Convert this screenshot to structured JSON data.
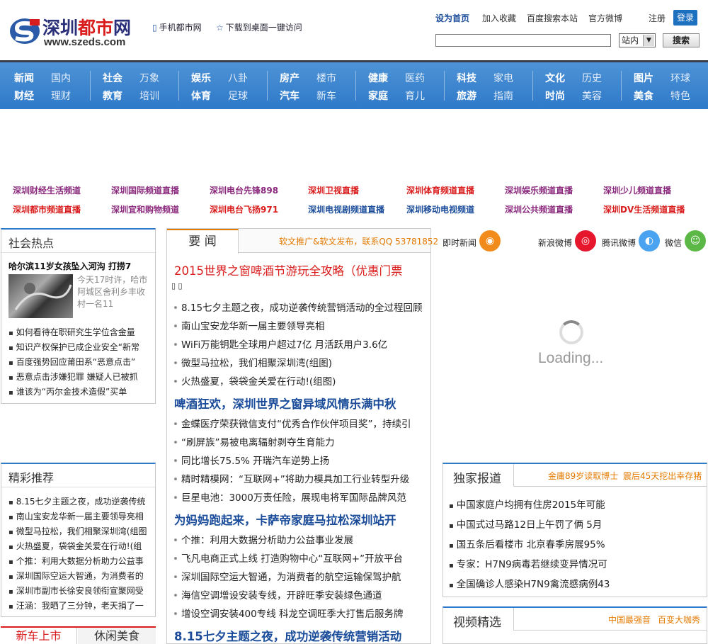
{
  "header": {
    "logo_name_a": "深圳",
    "logo_name_b": "都市",
    "logo_name_c": "网",
    "logo_url": "www.szeds.com",
    "mobile_link": "手机都市网",
    "desktop_link": "下载到桌面一键访问",
    "set_home": "设为首页",
    "add_fav": "加入收藏",
    "baidu_search": "百度搜索本站",
    "weibo": "官方微博",
    "register": "注册",
    "login": "登录",
    "search_placeholder": "",
    "search_scope": "站内",
    "search_button": "搜索"
  },
  "nav": [
    [
      "新闻",
      "国内",
      "财经",
      "理财"
    ],
    [
      "社会",
      "万象",
      "教育",
      "培训"
    ],
    [
      "娱乐",
      "八卦",
      "体育",
      "足球"
    ],
    [
      "房产",
      "楼市",
      "汽车",
      "新车"
    ],
    [
      "健康",
      "医药",
      "家庭",
      "育儿"
    ],
    [
      "科技",
      "家电",
      "旅游",
      "指南"
    ],
    [
      "文化",
      "历史",
      "时尚",
      "美容"
    ],
    [
      "图片",
      "环球",
      "美食",
      "特色"
    ]
  ],
  "channels": {
    "row1": [
      "深圳财经生活频道",
      "深圳国际频道直播",
      "深圳电台先锋898",
      "深圳卫视直播",
      "深圳体育频道直播",
      "深圳娱乐频道直播",
      "深圳少儿频道直播"
    ],
    "row2": [
      "深圳都市频道直播",
      "深圳宜和购物频道",
      "深圳电台飞扬971",
      "深圳电视剧频道直播",
      "深圳移动电视频道",
      "深圳公共频道直播",
      "深圳DV生活频道直播"
    ],
    "colors": {
      "purple": "#8b2a7d",
      "red": "#d91c1c",
      "blue": "#1a4c9a"
    }
  },
  "hot": {
    "title": "社会热点",
    "top_title": "哈尔滨11岁女孩坠入河沟 打捞7",
    "top_summary": "今天17时许，哈市阿城区舍利乡丰收村一名11",
    "items": [
      "如何看待在职研究生学位含金量",
      "知识产权保护已成企业安全“新常",
      "百度强势回应莆田系“恶意点击”",
      "恶意点击涉嫌犯罪 嫌疑人已被抓",
      "谁该为“丙尔金技术造假”买单"
    ]
  },
  "recommend": {
    "title": "精彩推荐",
    "items": [
      "8.15七夕主题之夜，成功逆袭传统",
      "南山宝安龙华新一届主要领导亮相",
      "微型马拉松，我们相聚深圳湾(组图",
      "火热盛夏，袋袋金关爱在行动!(组",
      "个推：利用大数据分析助力公益事",
      "深圳国际空运大智通，为消费者的",
      "深圳市副市长徐安良领衔宣聚网受",
      "汪涵：我晒了三分钟，老天捐了一"
    ]
  },
  "tabs": {
    "new_car": "新车上市",
    "food": "休闲美食"
  },
  "main": {
    "tab": "要 闻",
    "ad": "软文推广&软文发布，联系QQ 53781852",
    "headline1": "2015世界之窗啤酒节游玩全攻略（优惠门票",
    "headline1_tail": "▯ ▯",
    "list1": [
      "8.15七夕主题之夜，成功逆袭传统营销活动的全过程回顾",
      "南山宝安龙华新一届主要领导亮相",
      "WiFi万能钥匙全球用户超过7亿 月活跃用户3.6亿",
      "微型马拉松，我们相聚深圳湾(组图)",
      "火热盛夏，袋袋金关爱在行动!(组图)"
    ],
    "headline2": "啤酒狂欢，深圳世界之窗异域风情乐满中秋",
    "list2": [
      "金蝶医疗荣获微信支付“优秀合作伙伴项目奖”，持续引",
      "“刷屏族”易被电离辐射剥夺生育能力",
      "同比增长75.5% 开瑞汽车逆势上扬",
      "精时精模网：“互联网+”将助力模具加工行业转型升级",
      "巨星电池：3000万责任险，展现电将军国际品牌风范"
    ],
    "headline3": "为妈妈跑起来，卡萨帝家庭马拉松深圳站开",
    "list3": [
      "个推：利用大数据分析助力公益事业发展",
      "飞凡电商正式上线 打造购物中心“互联网+”开放平台",
      "深圳国际空运大智通，为消费者的航空运输保驾护航",
      "海信空调增设安装专线，开辟旺季安装绿色通道",
      "增设空调安装400专线 科龙空调旺季大打售后服务牌"
    ],
    "headline4": "8.15七夕主题之夜，成功逆袭传统营销活动"
  },
  "social": {
    "instant": "即时新闻",
    "sina": "新浪微博",
    "tencent": "腾讯微博",
    "wechat": "微信",
    "loading": "Loading..."
  },
  "exclusive": {
    "title": "独家报道",
    "link1": "金庸89岁读取博士",
    "link2": "震后45天挖出幸存猪",
    "items": [
      "中国家庭户均拥有住房2015年可能",
      "中国式过马路12日上午罚了俩 5月",
      "国五条后看楼市 北京春季房展95%",
      "专家：H7N9病毒若继续变异情况可",
      "全国确诊人感染H7N9禽流感病例43"
    ]
  },
  "video": {
    "title": "视频精选",
    "link1": "中国最强音",
    "link2": "百变大咖秀"
  }
}
